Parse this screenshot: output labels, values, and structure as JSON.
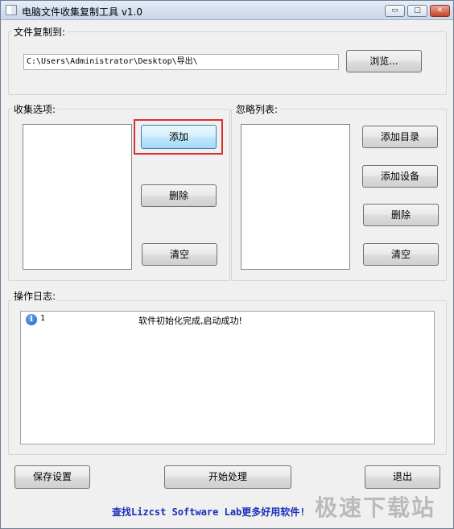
{
  "window": {
    "title": "电脑文件收集复制工具 v1.0",
    "controls": {
      "minimize": "▭",
      "maximize": "□",
      "close": "✕"
    }
  },
  "copy_to": {
    "label": "文件复制到:",
    "path": "C:\\Users\\Administrator\\Desktop\\导出\\",
    "browse_label": "浏览..."
  },
  "collect": {
    "label": "收集选项:",
    "add_label": "添加",
    "delete_label": "删除",
    "clear_label": "清空"
  },
  "ignore": {
    "label": "忽略列表:",
    "add_dir_label": "添加目录",
    "add_device_label": "添加设备",
    "delete_label": "删除",
    "clear_label": "清空"
  },
  "log": {
    "label": "操作日志:",
    "entries": [
      {
        "icon": "info-icon",
        "index": "1",
        "message": "软件初始化完成,启动成功!"
      }
    ]
  },
  "footer": {
    "save_label": "保存设置",
    "start_label": "开始处理",
    "exit_label": "退出",
    "promo": "查找Lizcst Software Lab更多好用软件!"
  },
  "watermark": "极速下载站",
  "colors": {
    "highlight": "#d9302f",
    "promo": "#1a2fb8",
    "hot_button": "#bee6fd"
  }
}
